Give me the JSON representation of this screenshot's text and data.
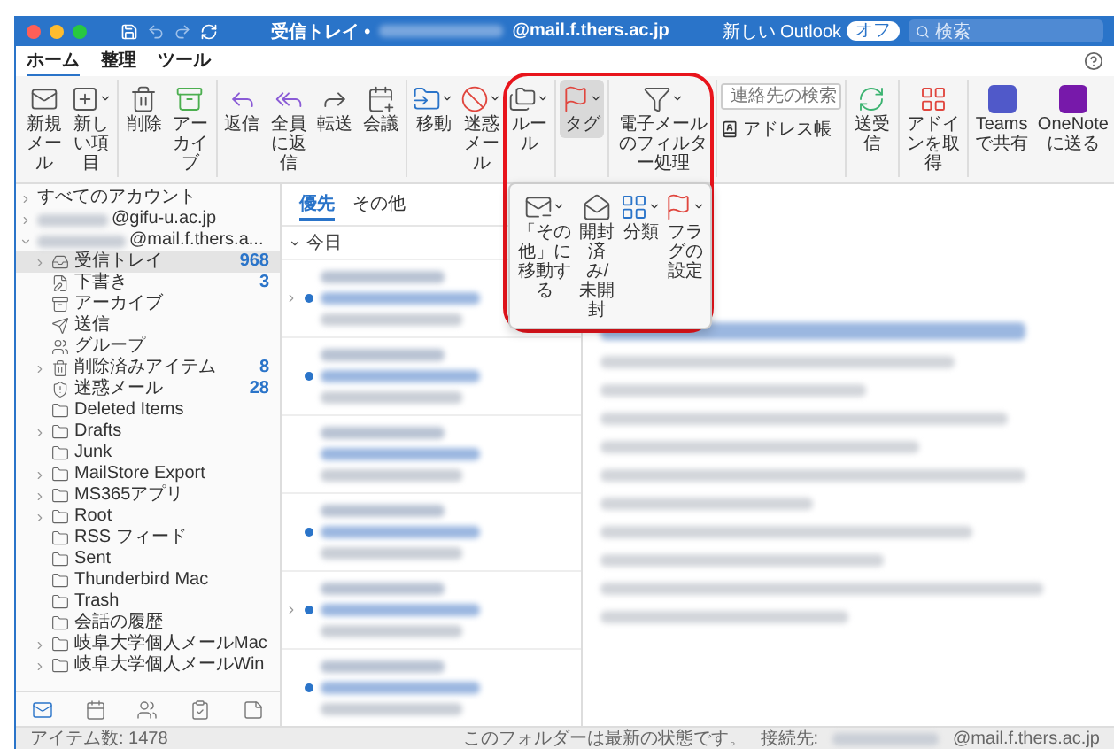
{
  "window": {
    "title": "受信トレイ •",
    "title_account": "@mail.f.thers.ac.jp",
    "new_outlook": {
      "label": "新しい Outlook",
      "toggle": "オフ",
      "on": false
    },
    "search": {
      "placeholder": "検索"
    }
  },
  "tabs": [
    {
      "label": "ホーム",
      "selected": true
    },
    {
      "label": "整理",
      "selected": false
    },
    {
      "label": "ツール",
      "selected": false
    }
  ],
  "ribbon": {
    "groups": [
      {
        "kind": "buttons",
        "buttons": [
          {
            "label": "新規メール",
            "dropdown": false,
            "pressed": false
          },
          {
            "label": "新しい項目",
            "dropdown": true,
            "pressed": false
          }
        ]
      },
      {
        "kind": "buttons",
        "buttons": [
          {
            "label": "削除",
            "dropdown": false,
            "pressed": false
          },
          {
            "label": "アーカイブ",
            "dropdown": false,
            "pressed": false
          }
        ]
      },
      {
        "kind": "buttons",
        "buttons": [
          {
            "label": "返信",
            "dropdown": false,
            "pressed": false
          },
          {
            "label": "全員に返信",
            "dropdown": false,
            "pressed": false
          },
          {
            "label": "転送",
            "dropdown": false,
            "pressed": false
          },
          {
            "label": "会議",
            "dropdown": false,
            "pressed": false
          }
        ]
      },
      {
        "kind": "buttons",
        "buttons": [
          {
            "label": "移動",
            "dropdown": true,
            "pressed": false
          },
          {
            "label": "迷惑メール",
            "dropdown": true,
            "pressed": false
          },
          {
            "label": "ルール",
            "dropdown": true,
            "pressed": false
          }
        ]
      },
      {
        "kind": "buttons",
        "buttons": [
          {
            "label": "タグ",
            "dropdown": true,
            "pressed": true
          }
        ]
      },
      {
        "kind": "buttons",
        "buttons": [
          {
            "label": "電子メールのフィルター処理",
            "dropdown": true,
            "pressed": false
          }
        ]
      },
      {
        "kind": "search",
        "placeholder": "連絡先の検索",
        "link": "アドレス帳"
      },
      {
        "kind": "buttons",
        "buttons": [
          {
            "label": "送受信",
            "dropdown": false,
            "pressed": false
          }
        ]
      },
      {
        "kind": "buttons",
        "buttons": [
          {
            "label": "アドインを取得",
            "dropdown": false,
            "pressed": false
          }
        ]
      },
      {
        "kind": "buttons",
        "buttons": [
          {
            "label": "Teams で共有",
            "dropdown": false,
            "pressed": false
          },
          {
            "label": "OneNote に送る",
            "dropdown": false,
            "pressed": false
          }
        ]
      }
    ]
  },
  "tag_menu": [
    {
      "label": "「その他」に移動する",
      "dropdown": true
    },
    {
      "label": "開封済み/未開封",
      "dropdown": false
    },
    {
      "label": "分類",
      "dropdown": true
    },
    {
      "label": "フラグの設定",
      "dropdown": true
    }
  ],
  "sidebar": {
    "accounts": [
      {
        "label": "すべてのアカウント",
        "expanded": false,
        "redacted": false
      },
      {
        "label": "@gifu-u.ac.jp",
        "expanded": false,
        "redacted": true
      },
      {
        "label": "@mail.f.thers.a...",
        "expanded": true,
        "redacted": true,
        "children": [
          {
            "label": "受信トレイ",
            "count": "968",
            "selected": true,
            "expandable": true
          },
          {
            "label": "下書き",
            "count": "3",
            "selected": false,
            "expandable": false
          },
          {
            "label": "アーカイブ",
            "selected": false,
            "expandable": false
          },
          {
            "label": "送信",
            "selected": false,
            "expandable": false
          },
          {
            "label": "グループ",
            "selected": false,
            "expandable": false
          },
          {
            "label": "削除済みアイテム",
            "count": "8",
            "selected": false,
            "expandable": true
          },
          {
            "label": "迷惑メール",
            "count": "28",
            "selected": false,
            "expandable": false
          },
          {
            "label": "Deleted Items",
            "selected": false,
            "expandable": false
          },
          {
            "label": "Drafts",
            "selected": false,
            "expandable": true
          },
          {
            "label": "Junk",
            "selected": false,
            "expandable": false
          },
          {
            "label": "MailStore Export",
            "selected": false,
            "expandable": true
          },
          {
            "label": "MS365アプリ",
            "selected": false,
            "expandable": true
          },
          {
            "label": "Root",
            "selected": false,
            "expandable": true
          },
          {
            "label": "RSS フィード",
            "selected": false,
            "expandable": false
          },
          {
            "label": "Sent",
            "selected": false,
            "expandable": false
          },
          {
            "label": "Thunderbird Mac",
            "selected": false,
            "expandable": false
          },
          {
            "label": "Trash",
            "selected": false,
            "expandable": false
          },
          {
            "label": "会話の履歴",
            "selected": false,
            "expandable": false
          },
          {
            "label": "岐阜大学個人メールMac",
            "selected": false,
            "expandable": true
          },
          {
            "label": "岐阜大学個人メールWin",
            "selected": false,
            "expandable": true
          }
        ]
      }
    ],
    "nav": [
      {
        "selected": true
      },
      {
        "selected": false
      },
      {
        "selected": false
      },
      {
        "selected": false
      },
      {
        "selected": false
      }
    ]
  },
  "message_list": {
    "tabs": [
      {
        "label": "優先",
        "selected": true
      },
      {
        "label": "その他",
        "selected": false
      }
    ],
    "group": "今日",
    "items": [
      {
        "unread": true,
        "thread": true
      },
      {
        "unread": true,
        "thread": false
      },
      {
        "unread": false,
        "thread": false
      },
      {
        "unread": true,
        "thread": false
      },
      {
        "unread": true,
        "thread": true
      },
      {
        "unread": true,
        "thread": false
      }
    ]
  },
  "status_bar": {
    "item_count": "アイテム数: 1478",
    "sync": "このフォルダーは最新の状態です。",
    "connected_label": "接続先:",
    "account": "@mail.f.thers.ac.jp"
  }
}
